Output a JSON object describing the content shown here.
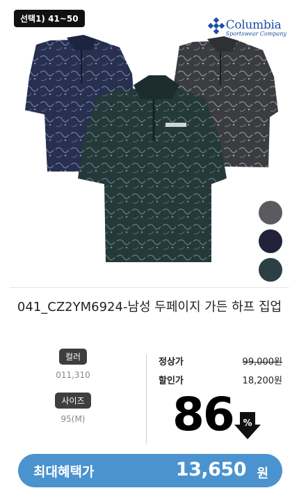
{
  "badge": "선택1) 41~50",
  "brand": {
    "name": "Columbia",
    "sub": "Sportswear Company"
  },
  "colors": {
    "swatches": [
      "#5a5b5f",
      "#22223a",
      "#2c3f45"
    ],
    "accent": "#4a93cf"
  },
  "product": {
    "title": "041_CZ2YM6924-남성 두페이지 가든 하프 집업"
  },
  "options": {
    "color_label": "컬러",
    "color_value": "011,310",
    "size_label": "사이즈",
    "size_value": "95(M)"
  },
  "price": {
    "regular_label": "정상가",
    "regular_value": "99,000원",
    "sale_label": "할인가",
    "sale_value": "18,200원",
    "discount_value": "86",
    "discount_unit": "%"
  },
  "cta": {
    "label": "최대혜택가",
    "amount": "13,650",
    "unit": "원"
  }
}
